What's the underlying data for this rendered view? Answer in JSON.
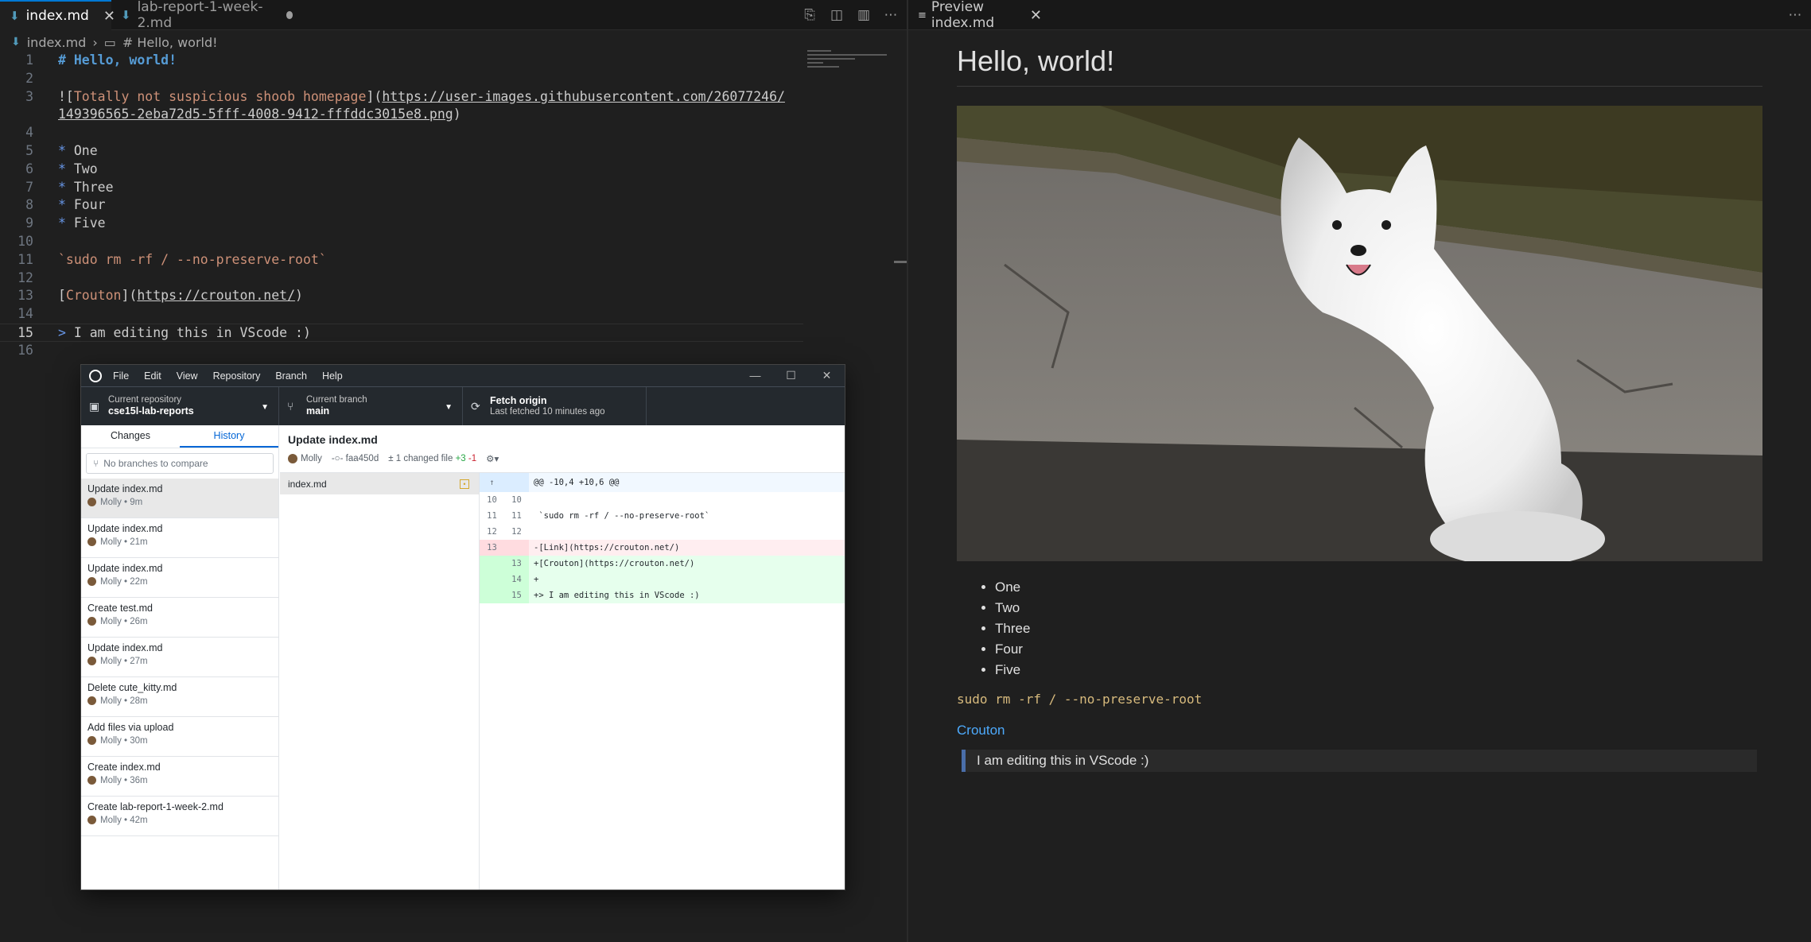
{
  "editor": {
    "tabs": [
      {
        "label": "index.md",
        "active": true
      },
      {
        "label": "lab-report-1-week-2.md",
        "active": false
      }
    ],
    "breadcrumb": {
      "file": "index.md",
      "symbol": "# Hello, world!"
    },
    "lines": [
      {
        "n": "1",
        "heading": "# Hello, world!"
      },
      {
        "n": "2"
      },
      {
        "n": "3",
        "prefix": "![",
        "alt": "Totally not suspicious shoob homepage",
        "mid": "](",
        "url": "https://user-images.githubusercontent.com/26077246/"
      },
      {
        "n": "",
        "url": "149396565-2eba72d5-5fff-4008-9412-fffddc3015e8.png",
        "suffix": ")"
      },
      {
        "n": "4"
      },
      {
        "n": "5",
        "bullet": "*",
        "text": " One"
      },
      {
        "n": "6",
        "bullet": "*",
        "text": " Two"
      },
      {
        "n": "7",
        "bullet": "*",
        "text": " Three"
      },
      {
        "n": "8",
        "bullet": "*",
        "text": " Four"
      },
      {
        "n": "9",
        "bullet": "*",
        "text": " Five"
      },
      {
        "n": "10"
      },
      {
        "n": "11",
        "code": "`sudo rm -rf / --no-preserve-root`"
      },
      {
        "n": "12"
      },
      {
        "n": "13",
        "prefix": "[",
        "alt": "Crouton",
        "mid": "](",
        "url": "https://crouton.net/",
        "suffix": ")"
      },
      {
        "n": "14"
      },
      {
        "n": "15",
        "bullet": ">",
        "text": " I am editing this in VScode :)",
        "current": true
      },
      {
        "n": "16"
      }
    ]
  },
  "preview": {
    "tab_label": "Preview index.md",
    "h1": "Hello, world!",
    "image_alt": "Totally not suspicious shoob homepage",
    "list": [
      "One",
      "Two",
      "Three",
      "Four",
      "Five"
    ],
    "code": "sudo rm -rf / --no-preserve-root",
    "link": "Crouton",
    "quote": "I am editing this in VScode :)"
  },
  "github_desktop": {
    "menus": [
      "File",
      "Edit",
      "View",
      "Repository",
      "Branch",
      "Help"
    ],
    "repo": {
      "label": "Current repository",
      "value": "cse15l-lab-reports"
    },
    "branch": {
      "label": "Current branch",
      "value": "main"
    },
    "fetch": {
      "label": "Fetch origin",
      "sub": "Last fetched 10 minutes ago"
    },
    "tabs": [
      "Changes",
      "History"
    ],
    "search_placeholder": "No branches to compare",
    "commits": [
      {
        "title": "Update index.md",
        "meta": "Molly • 9m"
      },
      {
        "title": "Update index.md",
        "meta": "Molly • 21m"
      },
      {
        "title": "Update index.md",
        "meta": "Molly • 22m"
      },
      {
        "title": "Create test.md",
        "meta": "Molly • 26m"
      },
      {
        "title": "Update index.md",
        "meta": "Molly • 27m"
      },
      {
        "title": "Delete cute_kitty.md",
        "meta": "Molly • 28m"
      },
      {
        "title": "Add files via upload",
        "meta": "Molly • 30m"
      },
      {
        "title": "Create index.md",
        "meta": "Molly • 36m"
      },
      {
        "title": "Create lab-report-1-week-2.md",
        "meta": "Molly • 42m"
      }
    ],
    "detail": {
      "title": "Update index.md",
      "author": "Molly",
      "sha": "faa450d",
      "changed": "1 changed file",
      "additions": "+3",
      "deletions": "-1",
      "file": "index.md"
    },
    "diff": [
      {
        "type": "hunk",
        "a": "",
        "b": "",
        "text": "@@ -10,4 +10,6 @@"
      },
      {
        "type": "ctx",
        "a": "10",
        "b": "10",
        "text": ""
      },
      {
        "type": "ctx",
        "a": "11",
        "b": "11",
        "text": " `sudo rm -rf / --no-preserve-root`"
      },
      {
        "type": "ctx",
        "a": "12",
        "b": "12",
        "text": ""
      },
      {
        "type": "del",
        "a": "13",
        "b": "",
        "text": "-[Link](https://crouton.net/)"
      },
      {
        "type": "add",
        "a": "",
        "b": "13",
        "text": "+[Crouton](https://crouton.net/)"
      },
      {
        "type": "add",
        "a": "",
        "b": "14",
        "text": "+"
      },
      {
        "type": "add",
        "a": "",
        "b": "15",
        "text": "+> I am editing this in VScode :)"
      }
    ]
  }
}
